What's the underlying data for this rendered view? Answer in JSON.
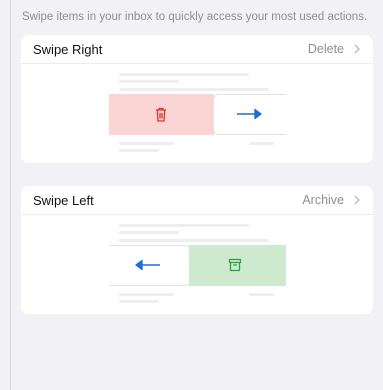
{
  "intro_text": "Swipe items in your inbox to quickly access your most used actions.",
  "swipe_right": {
    "title": "Swipe Right",
    "value": "Delete",
    "action_icon": "trash-icon",
    "arrow_icon": "arrow-right-icon",
    "action_color": "#e03131",
    "action_bg": "#fbd4d4",
    "arrow_color": "#1f6fd6"
  },
  "swipe_left": {
    "title": "Swipe Left",
    "value": "Archive",
    "action_icon": "archive-icon",
    "arrow_icon": "arrow-left-icon",
    "action_color": "#2f9e44",
    "action_bg": "#cdeacf",
    "arrow_color": "#1f6fd6"
  }
}
